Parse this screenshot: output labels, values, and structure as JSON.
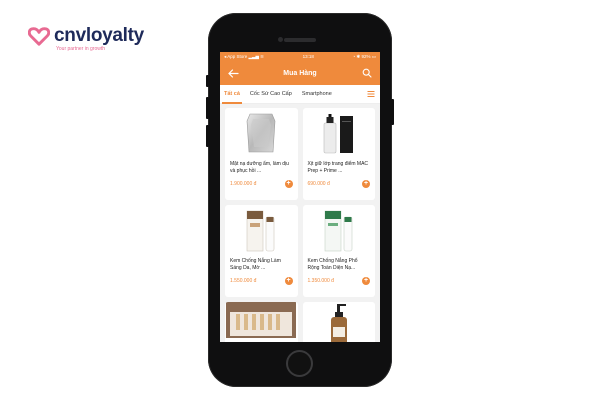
{
  "brand": {
    "name": "cnvloyalty",
    "tagline": "Your partner in growth",
    "color": "#1e2a5a",
    "accent": "#e86a92"
  },
  "status_bar": {
    "carrier": "App Store",
    "time": "13:18",
    "battery": "92%"
  },
  "nav": {
    "title": "Mua Hàng",
    "back_icon": "arrow-left-icon",
    "search_icon": "search-icon"
  },
  "tabs": [
    {
      "label": "Tất cả",
      "active": true
    },
    {
      "label": "Cốc Sứ Cao Cấp",
      "active": false
    },
    {
      "label": "Smartphone",
      "active": false
    }
  ],
  "accent_color": "#ef8a3c",
  "products": [
    {
      "name": "Mặt nạ dưỡng ẩm, làm dịu và phục hồi ...",
      "price": "1.900.000 đ",
      "image": "foil-mask-pack"
    },
    {
      "name": "Xịt giữ lớp trang điểm MAC Prep + Prime ...",
      "price": "690.000 đ",
      "image": "spray-bottle"
    },
    {
      "name": "Kem Chống Nắng Làm Sáng Da, Mờ ...",
      "price": "1.550.000 đ",
      "image": "sunscreen-tube-box"
    },
    {
      "name": "Kem Chống Nắng Phổ Rộng Toàn Diện Nạ...",
      "price": "1.350.000 đ",
      "image": "sunscreen-tube-box-green"
    },
    {
      "name": "",
      "price": "",
      "image": "ampoule-box"
    },
    {
      "name": "",
      "price": "",
      "image": "pump-bottle"
    }
  ]
}
